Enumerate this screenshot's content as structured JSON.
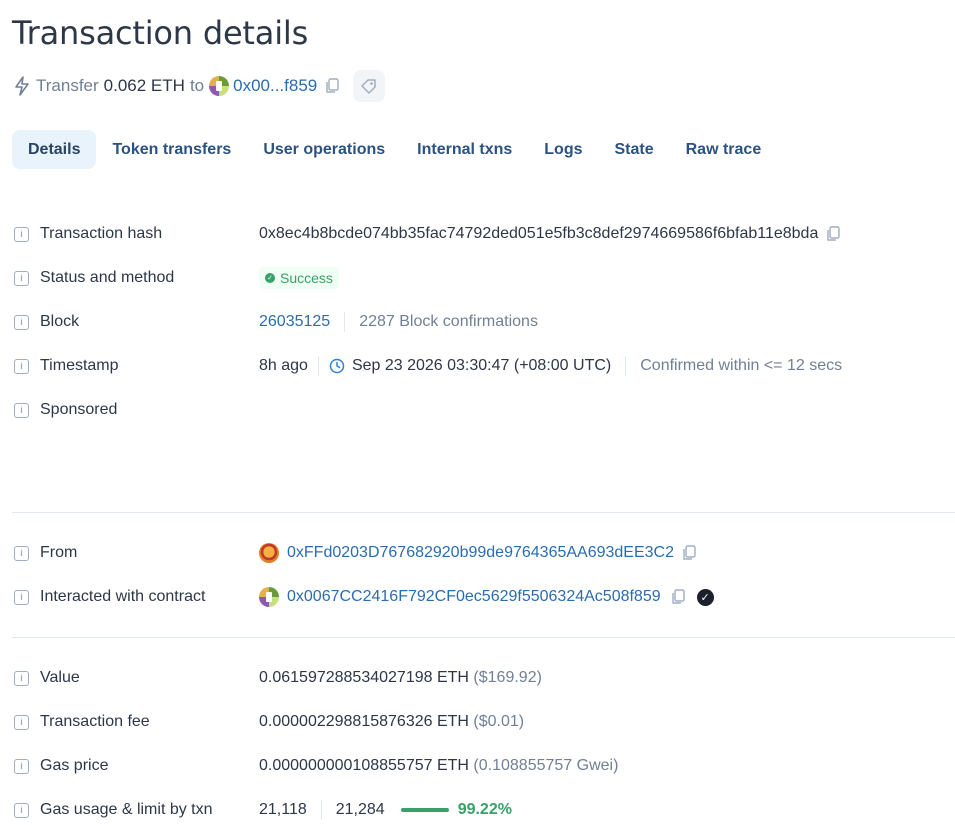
{
  "page": {
    "title": "Transaction details"
  },
  "summary": {
    "action": "Transfer",
    "amount": "0.062 ETH",
    "to_word": "to",
    "to_address": "0x00...f859",
    "icon": "lightning-bolt-icon"
  },
  "tabs": [
    {
      "label": "Details",
      "active": true
    },
    {
      "label": "Token transfers"
    },
    {
      "label": "User operations"
    },
    {
      "label": "Internal txns"
    },
    {
      "label": "Logs"
    },
    {
      "label": "State"
    },
    {
      "label": "Raw trace"
    }
  ],
  "details": {
    "hash": {
      "label": "Transaction hash",
      "value": "0x8ec4b8bcde074bb35fac74792ded051e5fb3c8def2974669586f6bfab11e8bda"
    },
    "status": {
      "label": "Status and method",
      "value": "Success"
    },
    "block": {
      "label": "Block",
      "number": "26035125",
      "confirmations": "2287 Block confirmations"
    },
    "timestamp": {
      "label": "Timestamp",
      "relative": "8h ago",
      "absolute": "Sep 23 2026 03:30:47 (+08:00 UTC)",
      "confirmed": "Confirmed within <= 12 secs"
    },
    "sponsored": {
      "label": "Sponsored"
    },
    "from": {
      "label": "From",
      "address": "0xFFd0203D767682920b99de9764365AA693dEE3C2"
    },
    "contract": {
      "label": "Interacted with contract",
      "address": "0x0067CC2416F792CF0ec5629f5506324Ac508f859"
    },
    "value": {
      "label": "Value",
      "amount": "0.061597288534027198",
      "unit": "ETH",
      "usd": "($169.92)"
    },
    "fee": {
      "label": "Transaction fee",
      "amount": "0.000002298815876326",
      "unit": "ETH",
      "usd": "($0.01)"
    },
    "gas_price": {
      "label": "Gas price",
      "amount": "0.000000000108855757",
      "unit": "ETH",
      "gwei": "(0.108855757 Gwei)"
    },
    "gas_usage": {
      "label": "Gas usage & limit by txn",
      "used": "21,118",
      "limit": "21,284",
      "percent": "99.22%",
      "fraction": 0.9922
    }
  },
  "colors": {
    "accent": "#2b6cb0",
    "success": "#38a169",
    "tab_active_bg": "#e9f3fb"
  }
}
